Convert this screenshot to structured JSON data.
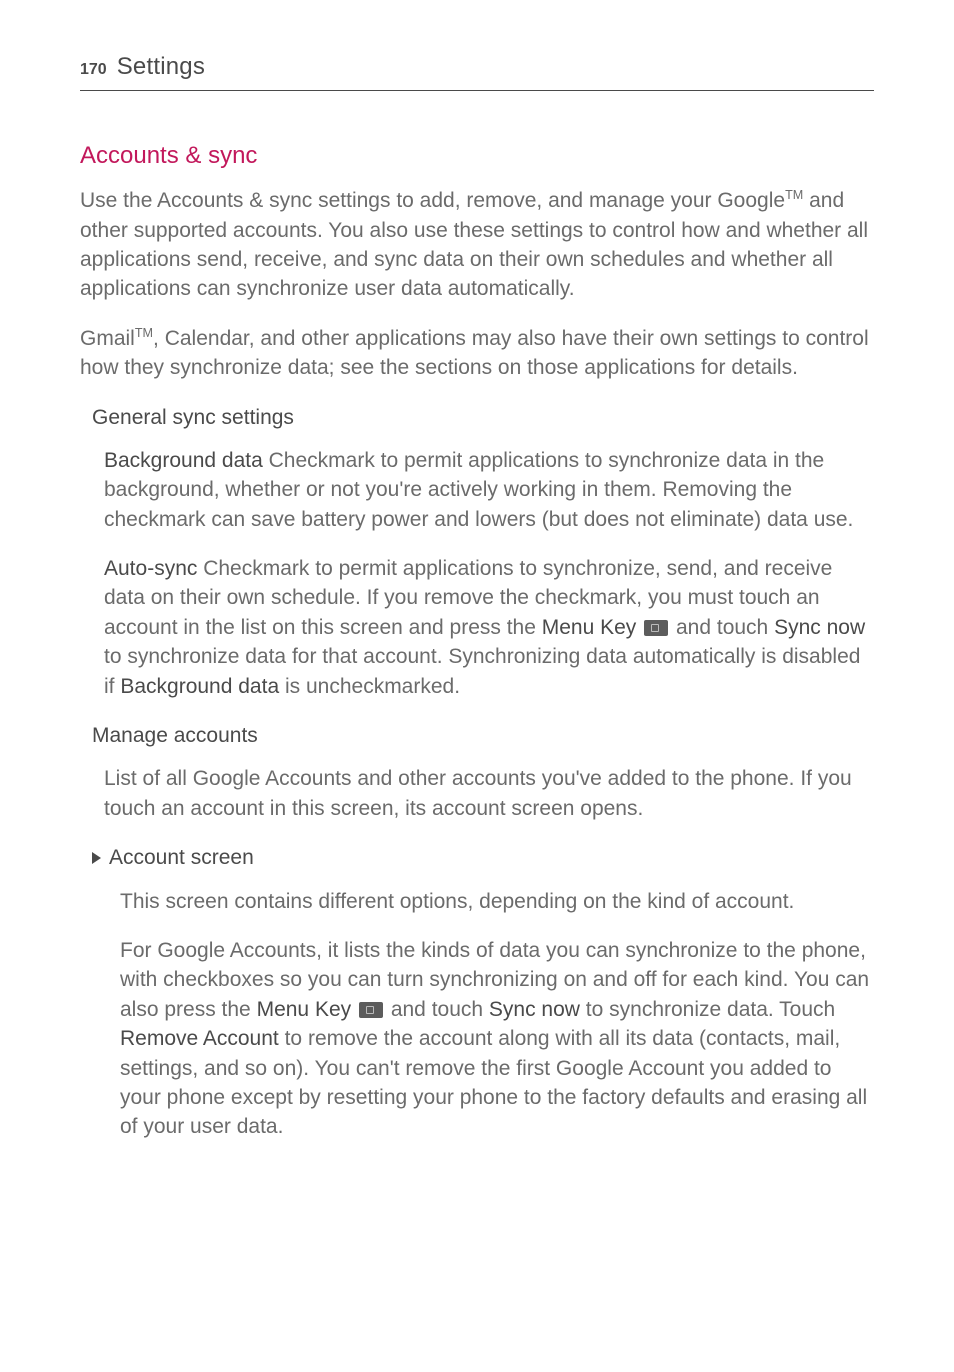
{
  "header": {
    "page_number": "170",
    "title": "Settings"
  },
  "section": {
    "title": "Accounts & sync",
    "p1_a": "Use the Accounts & sync settings to add, remove, and manage your Google",
    "p1_tm": "TM",
    "p1_b": " and other supported accounts. You also use these settings to control how and whether all applications send, receive, and sync data on their own schedules and whether all applications can synchronize user data automatically.",
    "p2_a": "Gmail",
    "p2_tm": "TM",
    "p2_b": ", Calendar, and other applications may also have their own settings to control how they synchronize data; see the sections on those applications for details."
  },
  "general_sync": {
    "heading": "General sync settings",
    "bg_label": "Background data",
    "bg_text": "  Checkmark to permit applications to synchronize data in the background, whether or not you're actively working in them. Removing the checkmark can save battery power and lowers (but does not eliminate) data use.",
    "auto_label": "Auto-sync",
    "auto_a": "  Checkmark to permit applications to synchronize, send, and receive data on their own schedule. If you remove the checkmark, you must touch an account in the list on this screen and press the ",
    "auto_menu_key": "Menu Key",
    "auto_b": " and touch ",
    "auto_sync_now": "Sync now",
    "auto_c": " to synchronize data for that account. Synchronizing data automatically is disabled if ",
    "auto_bg_ref": "Background data",
    "auto_d": " is uncheckmarked."
  },
  "manage": {
    "heading": "Manage accounts",
    "p1": "List of all Google Accounts and other accounts you've added to the phone. If you touch an account in this screen, its account screen opens."
  },
  "account_screen": {
    "heading": "Account screen",
    "p1": "This screen contains different options, depending on the kind of account.",
    "p2_a": "For Google Accounts, it lists the kinds of data you can synchronize to the phone, with checkboxes so you can turn synchronizing on and off for each kind. You can also press the ",
    "menu_key": "Menu Key",
    "p2_b": " and touch ",
    "sync_now": "Sync now",
    "p2_c": " to synchronize data. Touch ",
    "remove_account": "Remove Account",
    "p2_d": " to remove the account along with all its data (contacts, mail, settings, and so on). You can't remove the first Google Account you added to your phone except by resetting your phone to the factory defaults and erasing all of your user data."
  }
}
